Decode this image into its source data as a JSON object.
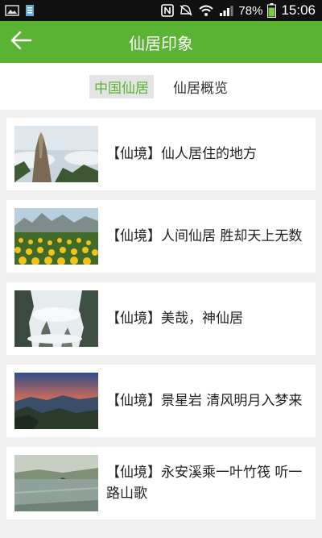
{
  "status_bar": {
    "battery_percent": "78%",
    "time": "15:06",
    "icons": [
      "gallery-icon",
      "file-icon",
      "nfc-icon",
      "mute-icon",
      "wifi-icon",
      "signal-icon",
      "battery-icon"
    ]
  },
  "app_bar": {
    "title": "仙居印象",
    "back_icon": "arrow-left-icon"
  },
  "tabs": [
    {
      "label": "中国仙居",
      "active": true
    },
    {
      "label": "仙居概览",
      "active": false
    }
  ],
  "articles": [
    {
      "title": "【仙境】仙人居住的地方",
      "image": "mountain-peak-clouds"
    },
    {
      "title": "【仙境】人间仙居 胜却天上无数",
      "image": "sunflower-field"
    },
    {
      "title": "【仙境】美哉，神仙居",
      "image": "misty-cliffs"
    },
    {
      "title": "【仙境】景星岩 清风明月入梦来",
      "image": "sunset-valley"
    },
    {
      "title": "【仙境】永安溪乘一叶竹筏 听一路山歌",
      "image": "river-landscape"
    }
  ],
  "colors": {
    "accent": "#5ab332",
    "background": "#efefef",
    "status_bar": "#111111"
  }
}
